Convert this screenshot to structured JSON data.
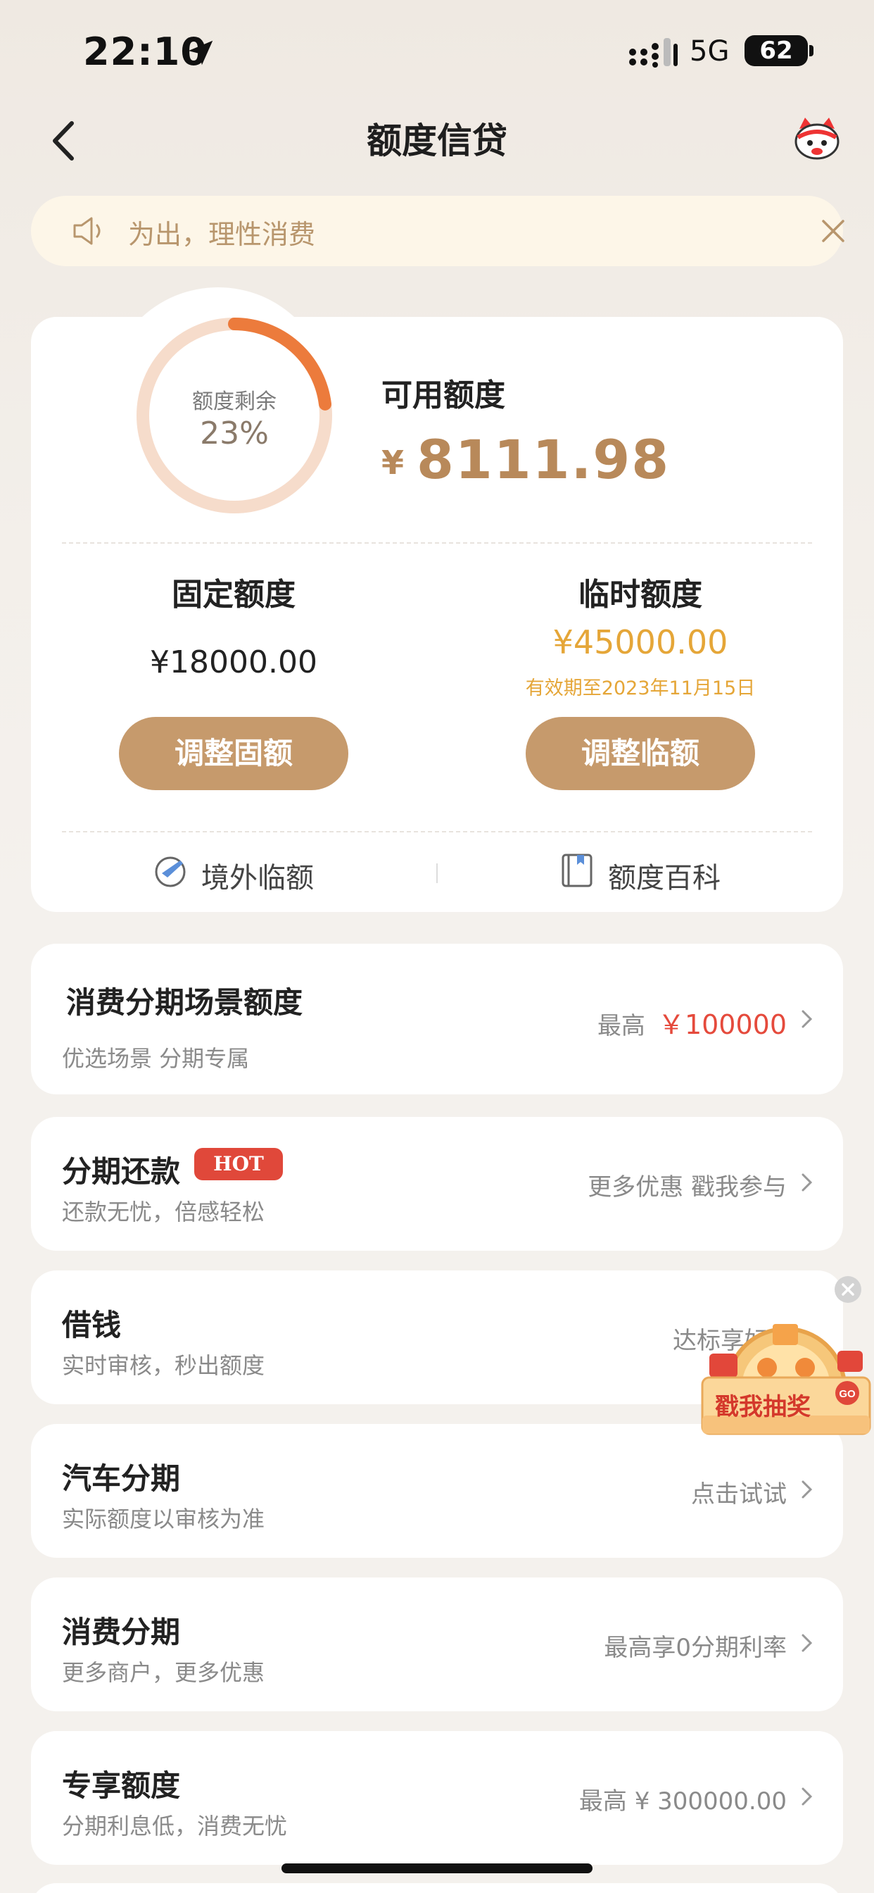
{
  "status_bar": {
    "time": "22:10",
    "network": "5G",
    "battery": "62"
  },
  "nav": {
    "title": "额度信贷"
  },
  "notice": {
    "text": "为出，理性消费"
  },
  "credit": {
    "ring_label": "额度剩余",
    "ring_percent": "23%",
    "remaining_fraction": 0.23,
    "available_label": "可用额度",
    "currency_symbol": "¥",
    "available_amount": "8111.98",
    "fixed_label": "固定额度",
    "fixed_amount": "¥18000.00",
    "temp_label": "临时额度",
    "temp_amount": "¥45000.00",
    "temp_valid": "有效期至2023年11月15日",
    "adjust_fixed_button": "调整固额",
    "adjust_temp_button": "调整临额",
    "overseas_link": "境外临额",
    "encyclopedia_link": "额度百科"
  },
  "list": [
    {
      "title": "消费分期场景额度",
      "sub": "优选场景 分期专属",
      "right_prefix": "最高",
      "right_value": "￥100000"
    },
    {
      "title": "分期还款",
      "badge": "HOT",
      "sub": "还款无忧，倍感轻松",
      "right": "更多优惠 戳我参与"
    },
    {
      "title": "借钱",
      "sub": "实时审核，秒出额度",
      "right": "达标享好"
    },
    {
      "title": "汽车分期",
      "sub": "实际额度以审核为准",
      "right": "点击试试"
    },
    {
      "title": "消费分期",
      "sub": "更多商户，更多优惠",
      "right": "最高享0分期利率"
    },
    {
      "title": "专享额度",
      "sub": "分期利息低，消费无忧",
      "right": "最高 ¥ 300000.00"
    }
  ],
  "floating": {
    "lottery_text": "戳我抽奖",
    "go": "GO"
  },
  "colors": {
    "accent": "#c69a6c",
    "amount": "#b8895a",
    "temp": "#e5a638",
    "red": "#e54a3c",
    "ring_track": "#f6dccb",
    "ring_fill": "#ec7b3c"
  }
}
